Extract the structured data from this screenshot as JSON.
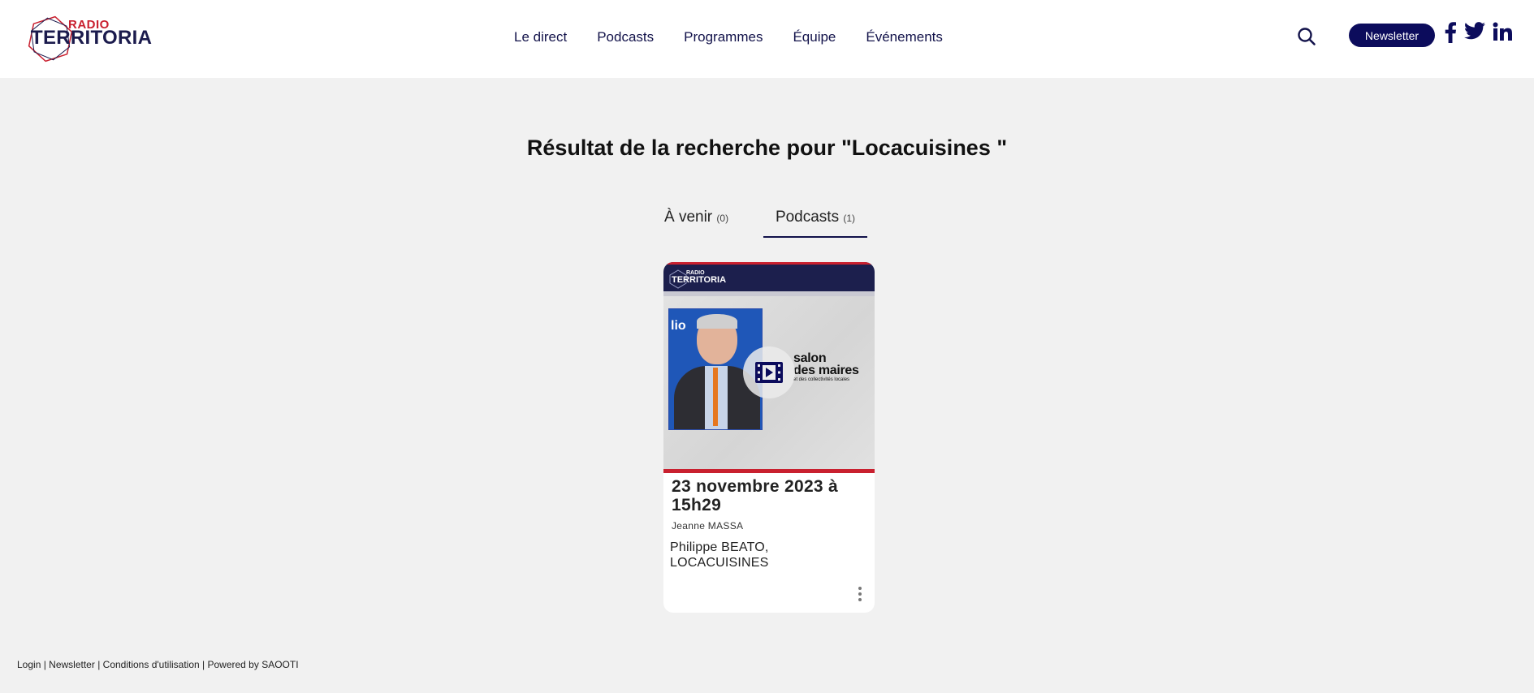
{
  "header": {
    "logo": {
      "radio": "RADIO",
      "name": "TERRITORIA"
    },
    "nav": [
      "Le direct",
      "Podcasts",
      "Programmes",
      "Équipe",
      "Événements"
    ],
    "newsletter_label": "Newsletter",
    "social_icons": [
      "facebook-icon",
      "twitter-icon",
      "linkedin-icon"
    ],
    "search_icon": "search-icon"
  },
  "search": {
    "title": "Résultat de la recherche pour \"Locacuisines \"",
    "tabs": [
      {
        "label": "À venir",
        "count": "(0)",
        "active": false
      },
      {
        "label": "Podcasts",
        "count": "(1)",
        "active": true
      }
    ]
  },
  "results": [
    {
      "thumbnail": {
        "logo_radio": "RADIO",
        "logo_name": "TERRITORIA",
        "brand_line1": "salon",
        "brand_line2": "des maires",
        "brand_line3": "et des collectivités locales",
        "photo_text": "lio"
      },
      "date": "23 novembre 2023 à 15h29",
      "author": "Jeanne MASSA",
      "description": "Philippe BEATO, LOCACUISINES"
    }
  ],
  "footer": {
    "login": "Login",
    "newsletter": "Newsletter",
    "terms": "Conditions d'utilisation",
    "powered": "Powered by SAOOTI",
    "separator": " | "
  },
  "colors": {
    "brand_navy": "#0c0c5c",
    "brand_red": "#c9202f",
    "background": "#f1f1f1"
  }
}
